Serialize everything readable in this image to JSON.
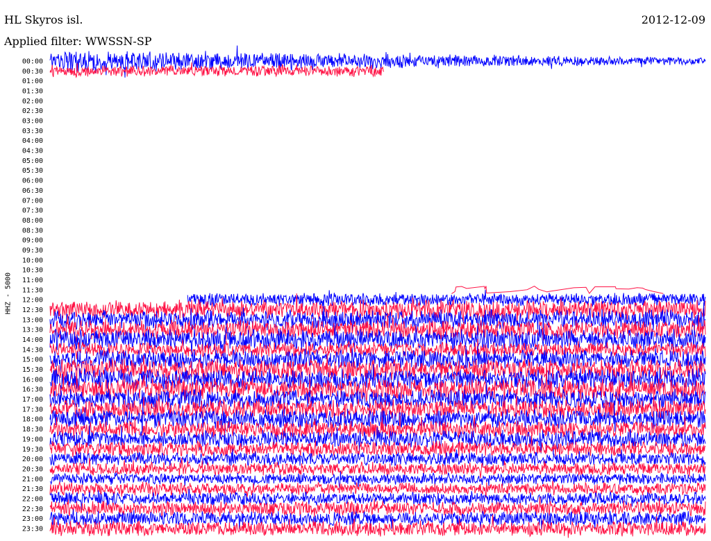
{
  "header": {
    "station": "HL Skyros isl.",
    "filter": "Applied filter: WWSSN-SP",
    "date": "2012-12-09",
    "channel": "HHZ - 5000"
  },
  "colors": {
    "trace_a": "#0000ff",
    "trace_b": "#ff1144",
    "background": "#ffffff"
  },
  "chart_data": {
    "type": "line",
    "title": "",
    "xlabel": "",
    "ylabel": "HHZ - 5000",
    "grid": false,
    "legend": "none",
    "row_labels": [
      "00:00",
      "00:30",
      "01:00",
      "01:30",
      "02:00",
      "02:30",
      "03:00",
      "03:30",
      "04:00",
      "04:30",
      "05:00",
      "05:30",
      "06:00",
      "06:30",
      "07:00",
      "07:30",
      "08:00",
      "08:30",
      "09:00",
      "09:30",
      "10:00",
      "10:30",
      "11:00",
      "11:30",
      "12:00",
      "12:30",
      "13:00",
      "13:30",
      "14:00",
      "14:30",
      "15:00",
      "15:30",
      "16:00",
      "16:30",
      "17:00",
      "17:30",
      "18:00",
      "18:30",
      "19:00",
      "19:30",
      "20:00",
      "20:30",
      "21:00",
      "21:30",
      "22:00",
      "22:30",
      "23:00",
      "23:30"
    ],
    "series": [
      {
        "row": "00:00",
        "color": "blue",
        "start_fraction": 0.0,
        "end_fraction": 1.0,
        "relative_amplitude": 1.0
      },
      {
        "row": "00:30",
        "color": "red",
        "start_fraction": 0.0,
        "end_fraction": 0.51,
        "relative_amplitude": 0.4
      },
      {
        "row": "11:30",
        "color": "red",
        "start_fraction": 0.6,
        "end_fraction": 0.95,
        "relative_amplitude": 0.2
      },
      {
        "row": "12:00",
        "color": "blue",
        "start_fraction": 0.21,
        "end_fraction": 1.0,
        "relative_amplitude": 0.5
      },
      {
        "row": "12:30",
        "color": "red",
        "start_fraction": 0.0,
        "end_fraction": 1.0,
        "relative_amplitude": 0.8
      },
      {
        "row": "13:00",
        "color": "blue",
        "start_fraction": 0.0,
        "end_fraction": 1.0,
        "relative_amplitude": 0.8
      },
      {
        "row": "13:30",
        "color": "red",
        "start_fraction": 0.0,
        "end_fraction": 1.0,
        "relative_amplitude": 0.8
      },
      {
        "row": "14:00",
        "color": "blue",
        "start_fraction": 0.0,
        "end_fraction": 1.0,
        "relative_amplitude": 0.9
      },
      {
        "row": "14:30",
        "color": "red",
        "start_fraction": 0.0,
        "end_fraction": 1.0,
        "relative_amplitude": 0.6
      },
      {
        "row": "15:00",
        "color": "blue",
        "start_fraction": 0.0,
        "end_fraction": 1.0,
        "relative_amplitude": 0.8
      },
      {
        "row": "15:30",
        "color": "red",
        "start_fraction": 0.0,
        "end_fraction": 1.0,
        "relative_amplitude": 0.9
      },
      {
        "row": "16:00",
        "color": "blue",
        "start_fraction": 0.0,
        "end_fraction": 1.0,
        "relative_amplitude": 0.9
      },
      {
        "row": "16:30",
        "color": "red",
        "start_fraction": 0.0,
        "end_fraction": 1.0,
        "relative_amplitude": 0.9
      },
      {
        "row": "17:00",
        "color": "blue",
        "start_fraction": 0.0,
        "end_fraction": 1.0,
        "relative_amplitude": 0.8
      },
      {
        "row": "17:30",
        "color": "red",
        "start_fraction": 0.0,
        "end_fraction": 1.0,
        "relative_amplitude": 0.8
      },
      {
        "row": "18:00",
        "color": "blue",
        "start_fraction": 0.0,
        "end_fraction": 1.0,
        "relative_amplitude": 0.8
      },
      {
        "row": "18:30",
        "color": "red",
        "start_fraction": 0.0,
        "end_fraction": 1.0,
        "relative_amplitude": 0.7
      },
      {
        "row": "19:00",
        "color": "blue",
        "start_fraction": 0.0,
        "end_fraction": 1.0,
        "relative_amplitude": 0.7
      },
      {
        "row": "19:30",
        "color": "red",
        "start_fraction": 0.0,
        "end_fraction": 1.0,
        "relative_amplitude": 0.6
      },
      {
        "row": "20:00",
        "color": "blue",
        "start_fraction": 0.0,
        "end_fraction": 1.0,
        "relative_amplitude": 0.5
      },
      {
        "row": "20:30",
        "color": "red",
        "start_fraction": 0.0,
        "end_fraction": 1.0,
        "relative_amplitude": 0.45
      },
      {
        "row": "21:00",
        "color": "blue",
        "start_fraction": 0.0,
        "end_fraction": 1.0,
        "relative_amplitude": 0.4
      },
      {
        "row": "21:30",
        "color": "red",
        "start_fraction": 0.0,
        "end_fraction": 1.0,
        "relative_amplitude": 0.45
      },
      {
        "row": "22:00",
        "color": "blue",
        "start_fraction": 0.0,
        "end_fraction": 1.0,
        "relative_amplitude": 0.5
      },
      {
        "row": "22:30",
        "color": "red",
        "start_fraction": 0.0,
        "end_fraction": 1.0,
        "relative_amplitude": 0.55
      },
      {
        "row": "23:00",
        "color": "blue",
        "start_fraction": 0.0,
        "end_fraction": 1.0,
        "relative_amplitude": 0.55
      },
      {
        "row": "23:30",
        "color": "red",
        "start_fraction": 0.0,
        "end_fraction": 1.0,
        "relative_amplitude": 0.6
      }
    ]
  }
}
